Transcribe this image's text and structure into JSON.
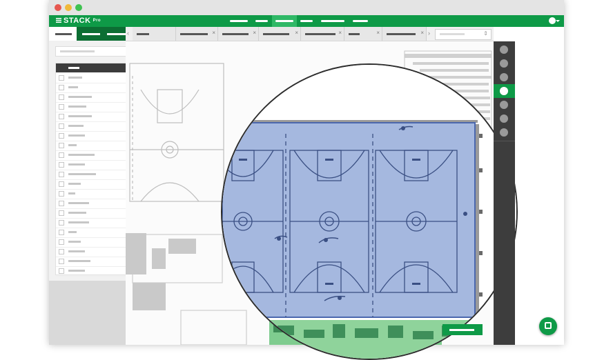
{
  "app": {
    "logo_text": "STACK",
    "logo_badge": "Pro",
    "logo_icon": "stack-logo-icon"
  },
  "window_controls": {
    "close_color": "#e6574f",
    "minimize_color": "#f0b93a",
    "maximize_color": "#3fc251"
  },
  "colors": {
    "brand_green": "#0e9a47",
    "brand_green_dark": "#0c6e33",
    "takeoff_blue": "#6f8fcf",
    "sitework_green": "#3fae5c",
    "tool_rail": "#3d3d3d"
  },
  "top_nav": {
    "items_count": 6,
    "active_index": 3
  },
  "sidebar": {
    "tabs_count": 3,
    "active_tab_index": 0,
    "add_button_icon": "plus-icon",
    "list_rows_count": 21,
    "status_color": "#13a34f"
  },
  "document_tabs": {
    "count": 7,
    "close_icon": "close-icon",
    "select_icon": "chevron-updown-icon"
  },
  "tool_rail": {
    "tools": [
      "tool-1-icon",
      "tool-2-icon",
      "tool-3-icon",
      "tool-4-icon",
      "tool-5-icon",
      "tool-6-icon",
      "tool-7-icon",
      "tool-8-icon"
    ],
    "active_index": 4
  },
  "magnifier": {
    "courts_count": 6,
    "overlay_color": "#6f8fcf"
  }
}
